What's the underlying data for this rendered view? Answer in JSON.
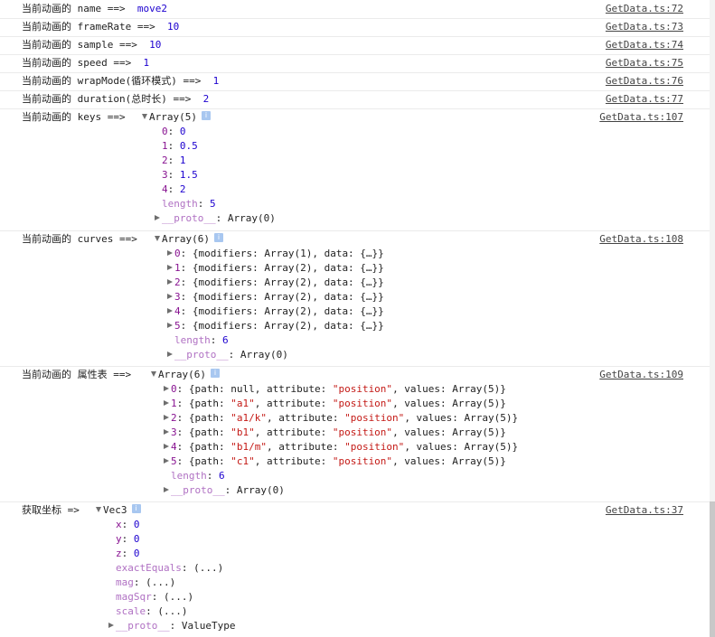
{
  "logs": [
    {
      "label": "当前动画的 name ==>",
      "value": "move2",
      "source": "GetData.ts:72"
    },
    {
      "label": "当前动画的 frameRate ==>",
      "value": "10",
      "source": "GetData.ts:73"
    },
    {
      "label": "当前动画的 sample ==>",
      "value": "10",
      "source": "GetData.ts:74"
    },
    {
      "label": "当前动画的 speed ==>",
      "value": "1",
      "source": "GetData.ts:75"
    },
    {
      "label": "当前动画的 wrapMode(循环模式) ==>",
      "value": "1",
      "source": "GetData.ts:76"
    },
    {
      "label": "当前动画的 duration(总时长) ==>",
      "value": "2",
      "source": "GetData.ts:77"
    }
  ],
  "keys": {
    "label": "当前动画的 keys ==>",
    "type": "Array(5)",
    "source": "GetData.ts:107",
    "items": [
      {
        "k": "0",
        "v": "0"
      },
      {
        "k": "1",
        "v": "0.5"
      },
      {
        "k": "2",
        "v": "1"
      },
      {
        "k": "3",
        "v": "1.5"
      },
      {
        "k": "4",
        "v": "2"
      }
    ],
    "length_label": "length",
    "length_value": "5",
    "proto_key": "__proto__",
    "proto_value": "Array(0)"
  },
  "curves": {
    "label": "当前动画的 curves ==>",
    "type": "Array(6)",
    "source": "GetData.ts:108",
    "items": [
      {
        "k": "0",
        "v": "{modifiers: Array(1), data: {…}}"
      },
      {
        "k": "1",
        "v": "{modifiers: Array(2), data: {…}}"
      },
      {
        "k": "2",
        "v": "{modifiers: Array(2), data: {…}}"
      },
      {
        "k": "3",
        "v": "{modifiers: Array(2), data: {…}}"
      },
      {
        "k": "4",
        "v": "{modifiers: Array(2), data: {…}}"
      },
      {
        "k": "5",
        "v": "{modifiers: Array(2), data: {…}}"
      }
    ],
    "length_label": "length",
    "length_value": "6",
    "proto_key": "__proto__",
    "proto_value": "Array(0)"
  },
  "props": {
    "label": "当前动画的 属性表 ==>",
    "type": "Array(6)",
    "source": "GetData.ts:109",
    "items": [
      {
        "k": "0",
        "path": "null",
        "path_is_string": false,
        "attribute": "\"position\"",
        "values": "Array(5)"
      },
      {
        "k": "1",
        "path": "\"a1\"",
        "path_is_string": true,
        "attribute": "\"position\"",
        "values": "Array(5)"
      },
      {
        "k": "2",
        "path": "\"a1/k\"",
        "path_is_string": true,
        "attribute": "\"position\"",
        "values": "Array(5)"
      },
      {
        "k": "3",
        "path": "\"b1\"",
        "path_is_string": true,
        "attribute": "\"position\"",
        "values": "Array(5)"
      },
      {
        "k": "4",
        "path": "\"b1/m\"",
        "path_is_string": true,
        "attribute": "\"position\"",
        "values": "Array(5)"
      },
      {
        "k": "5",
        "path": "\"c1\"",
        "path_is_string": true,
        "attribute": "\"position\"",
        "values": "Array(5)"
      }
    ],
    "length_label": "length",
    "length_value": "6",
    "proto_key": "__proto__",
    "proto_value": "Array(0)"
  },
  "coord": {
    "label": "获取坐标 =>",
    "type": "Vec3",
    "source": "GetData.ts:37",
    "fields": [
      {
        "k": "x",
        "v": "0"
      },
      {
        "k": "y",
        "v": "0"
      },
      {
        "k": "z",
        "v": "0"
      }
    ],
    "getters": [
      {
        "k": "exactEquals",
        "v": "(...)"
      },
      {
        "k": "mag",
        "v": "(...)"
      },
      {
        "k": "magSqr",
        "v": "(...)"
      },
      {
        "k": "scale",
        "v": "(...)"
      }
    ],
    "proto_key": "__proto__",
    "proto_value": "ValueType"
  },
  "colors": {
    "number": "#1c00cf",
    "key": "#881391",
    "string": "#c41a16",
    "dim_key": "#b071c3"
  }
}
